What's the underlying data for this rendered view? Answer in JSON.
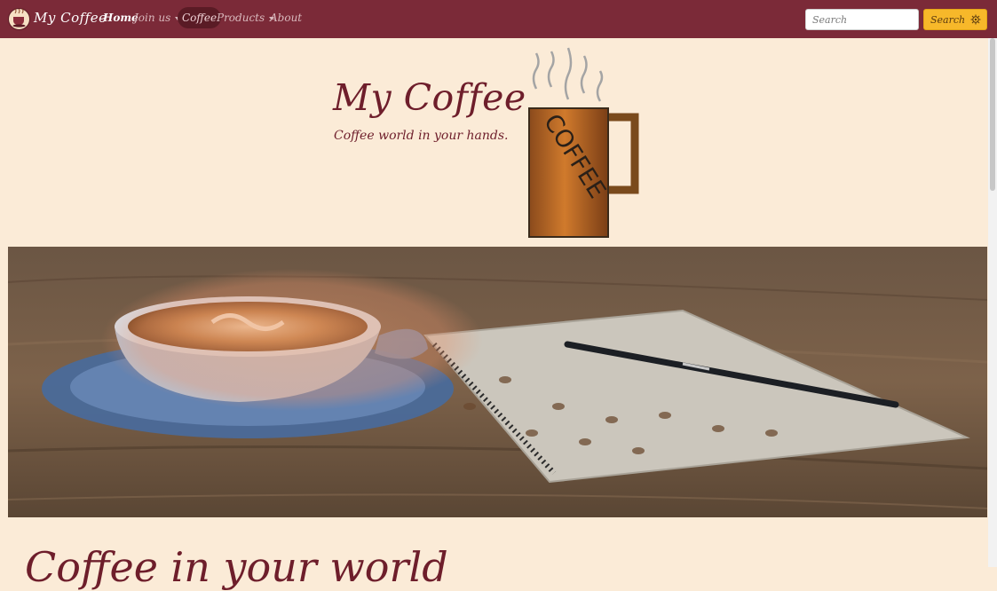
{
  "navbar": {
    "brand": "My Coffee",
    "items": [
      {
        "label": "Home"
      },
      {
        "label": "Join us"
      },
      {
        "label": "Coffee"
      },
      {
        "label": "Products"
      },
      {
        "label": "About"
      }
    ],
    "search": {
      "placeholder": "Search",
      "button_label": "Search"
    }
  },
  "hero": {
    "title": "My Coffee",
    "subtitle": "Coffee world in your hands.",
    "mug_label": "COFFEE"
  },
  "section": {
    "heading": "Coffee in your world"
  },
  "colors": {
    "navbar": "#7b2a38",
    "background": "#fbebd7",
    "accent": "#f7b82a",
    "title": "#6e1e2b"
  }
}
